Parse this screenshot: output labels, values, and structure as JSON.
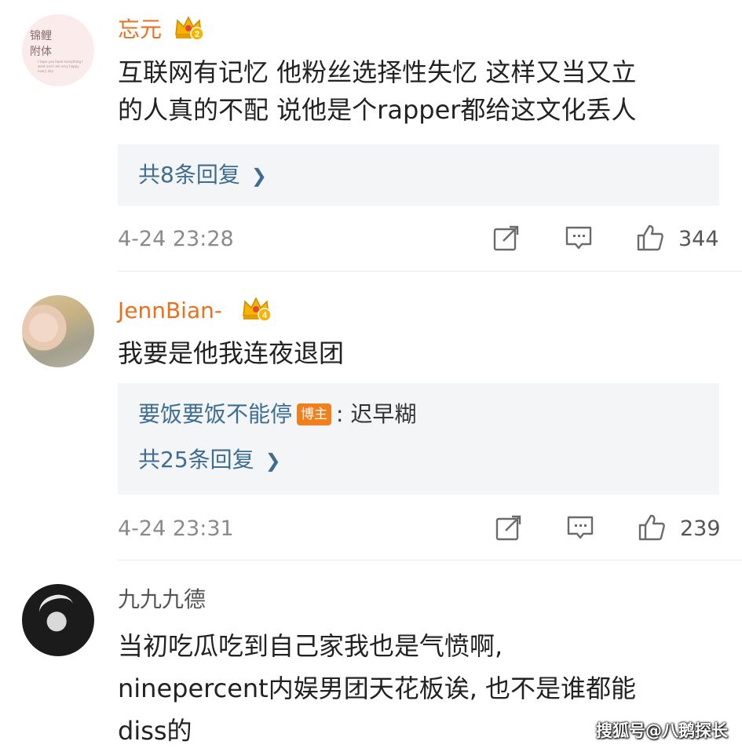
{
  "comments": [
    {
      "username": "忘元",
      "avatar_text": "锦鲤\n附体",
      "avatar_fine_text": "I hope you have everything I want and I am very happy every day",
      "content": "互联网有记忆 他粉丝选择性失忆 这样又当又立\n的人真的不配 说他是个rapper都给这文化丢人",
      "more_replies": "共8条回复",
      "timestamp": "4-24 23:28",
      "likes": "344",
      "crown_level": "2"
    },
    {
      "username": "JennBian-",
      "content": "我要是他我连夜退团",
      "reply_user": "要饭要饭不能停",
      "reply_badge": "博主",
      "reply_colon": ":",
      "reply_text": "迟早糊",
      "more_replies": "共25条回复",
      "timestamp": "4-24 23:31",
      "likes": "239",
      "crown_level": "4"
    },
    {
      "username": "九九九德",
      "content": "当初吃瓜吃到自己家我也是气愤啊,\nninepercent内娱男团天花板诶, 也不是谁都能\ndiss的"
    }
  ],
  "icons": {
    "crown": "crown-icon",
    "repost": "repost-icon",
    "comment": "comment-icon",
    "like": "like-icon",
    "chevron": "chevron-right-icon"
  },
  "colors": {
    "username": "#e8701f",
    "link": "#3e6d93",
    "reply_bg": "#f4f5f7",
    "badge": "#f07f1d",
    "muted": "#8a8a8a"
  },
  "watermark": "搜狐号@八鹅探长"
}
